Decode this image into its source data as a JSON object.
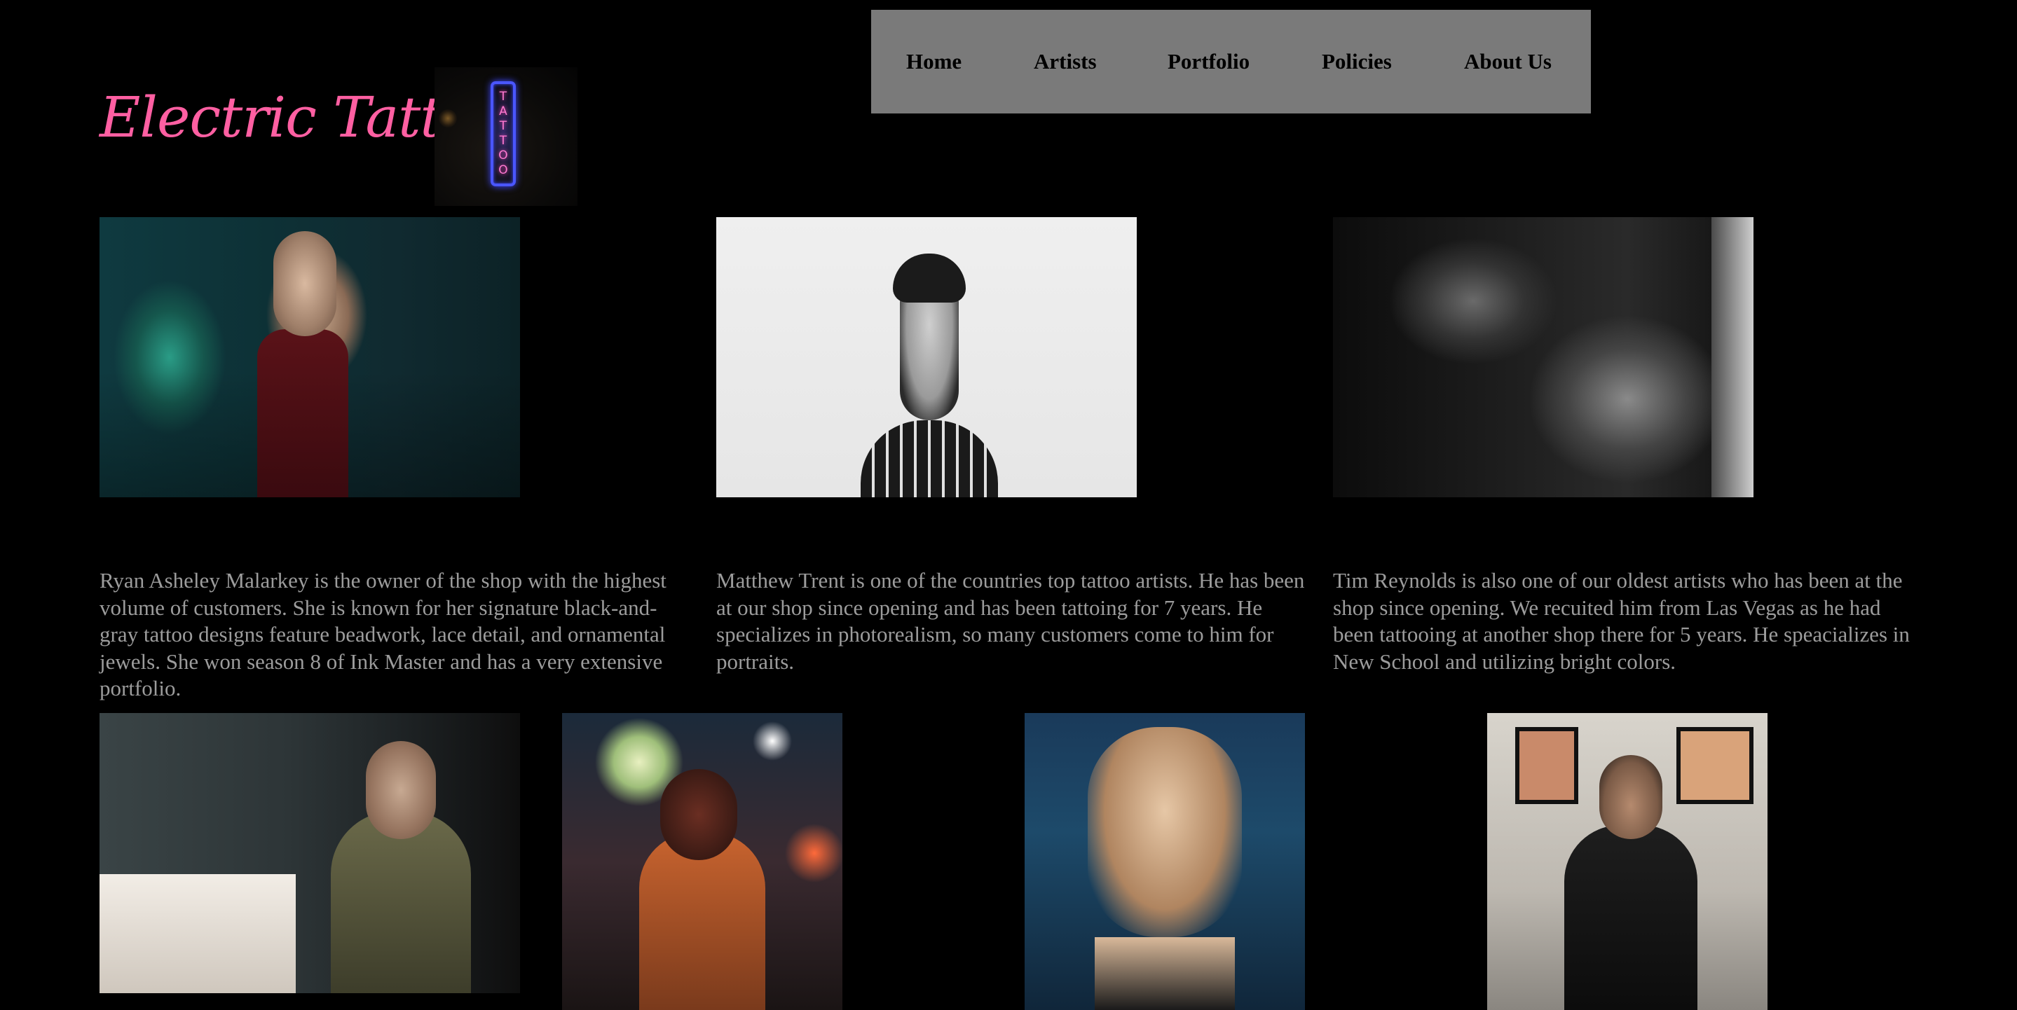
{
  "logo": {
    "title": "Electric Tattoo",
    "sign_text": "TATTOO"
  },
  "nav": {
    "items": [
      {
        "label": "Home"
      },
      {
        "label": "Artists"
      },
      {
        "label": "Portfolio"
      },
      {
        "label": "Policies"
      },
      {
        "label": "About Us"
      }
    ]
  },
  "artists": [
    {
      "bio": "Ryan Asheley Malarkey is the owner of the shop with the highest volume of customers. She is known for her signature black-and-gray tattoo designs feature beadwork, lace detail, and ornamental jewels. She won season 8 of Ink Master and has a very extensive portfolio."
    },
    {
      "bio": "Matthew Trent is one of the countries top tattoo artists. He has been at our shop since opening and has been tattoing for 7 years. He specializes in photorealism, so many customers come to him for portraits."
    },
    {
      "bio": "Tim Reynolds is also one of our oldest artists who has been at the shop since opening. We recuited him from Las Vegas as he had been tattooing at another shop there for 5 years. He speacializes in New School and utilizing bright colors."
    }
  ],
  "colors": {
    "background": "#000000",
    "nav_background": "#7a7a7a",
    "logo": "#ff5fa2",
    "body_text": "#9c9c9c"
  }
}
